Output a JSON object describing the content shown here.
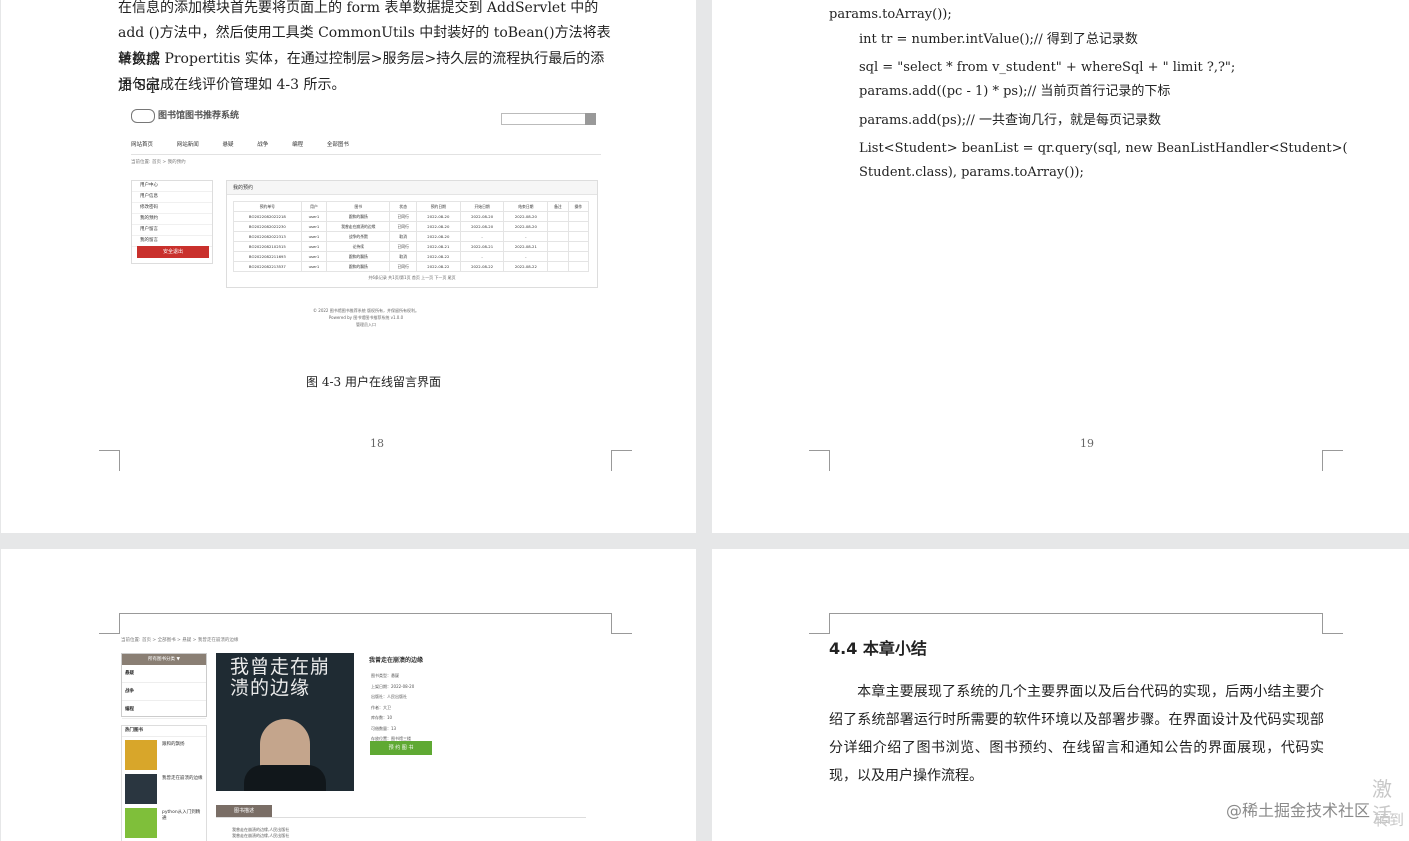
{
  "page18": {
    "para_lines": [
      "在信息的添加模块首先要将页面上的 form 表单数据提交到 AddServlet 中的",
      "add ()方法中，然后使用工具类 CommonUtils 中封装好的 toBean()方法将表单数据",
      "转换成 Propertitis 实体，在通过控制层>服务层>持久层的流程执行最后的添加 Sql",
      "语句完成在线评价管理如 4-3 所示。"
    ],
    "screenshot": {
      "logo": "图书馆图书推荐系统",
      "nav": [
        "网站首页",
        "网站新闻",
        "悬疑",
        "战争",
        "编程",
        "全部图书"
      ],
      "breadcrumb": "当前位置: 首页 > 我的预约",
      "sidebar": [
        "用户中心",
        "用户信息",
        "修改密码",
        "我的预约",
        "用户留言",
        "我的留言"
      ],
      "logout": "安全退出",
      "panel_title": "我的预约",
      "table_headers": [
        "预约单号",
        "用户",
        "图书",
        "状态",
        "预约日期",
        "开始日期",
        "结束日期",
        "备注",
        "操作"
      ],
      "rows": [
        [
          "BO2022082022218",
          "user1",
          "跟和的飘扬",
          "已同行",
          "2022-08-20",
          "2022-08-20",
          "2022-08-20",
          "",
          ""
        ],
        [
          "BO2022082022230",
          "user1",
          "我曾走在崩溃的边缘",
          "已同行",
          "2022-08-20",
          "2022-08-20",
          "2022-08-20",
          "",
          ""
        ],
        [
          "BO2022082022313",
          "user1",
          "战争的杀戮",
          "取消",
          "2022-08-20",
          "-",
          "-",
          "",
          ""
        ],
        [
          "BO2022082102515",
          "user1",
          "论持续",
          "已同行",
          "2022-08-21",
          "2022-08-21",
          "2022-08-21",
          "",
          ""
        ],
        [
          "BO2022082211693",
          "user1",
          "跟和的飘扬",
          "取消",
          "2022-08-22",
          "-",
          "-",
          "",
          ""
        ],
        [
          "BO2022082213537",
          "user1",
          "跟和的飘扬",
          "已同行",
          "2022-08-22",
          "2022-08-22",
          "2022-08-22",
          "",
          ""
        ]
      ],
      "pager": "共6条记录  共1页/第1页  首页  上一页  下一页  尾页",
      "footer": [
        "© 2022 图书馆图书推荐系统 版权所有，并保留所有权利。",
        "Powered by 图书馆图书推荐系统 v1.0.0",
        "管理员入口"
      ]
    },
    "caption": "图  4-3  用户在线留言界面",
    "page_number": "18"
  },
  "page19": {
    "code_lines": [
      "params.toArray());",
      "int tr = number.intValue();//  得到了总记录数",
      "sql = \"select * from v_student\" + whereSql + \" limit ?,?\";",
      "params.add((pc - 1) * ps);//  当前页首行记录的下标",
      "params.add(ps);//  一共查询几行，就是每页记录数",
      "List<Student> beanList = qr.query(sql, new BeanListHandler<Student>(",
      "Student.class), params.toArray());"
    ],
    "page_number": "19"
  },
  "page20": {
    "breadcrumb": "当前位置: 首页 > 全部图书 > 悬疑 > 我曾走在崩溃的边缘",
    "category_header": "所有图书分类 ▼",
    "categories": [
      "悬疑",
      "战争",
      "编程"
    ],
    "hot_header": "热门图书",
    "hot_books": [
      "跟和的飘扬",
      "我曾走在崩溃的边缘",
      "python从入门到精通"
    ],
    "cover_title": "我曾走在崩溃的边缘",
    "book_title": "我曾走在崩溃的边缘",
    "meta": [
      "图书类型：悬疑",
      "上架日期：2022-08-20",
      "出版社：人民出版社",
      "作者：大卫",
      "库存数：10",
      "可借数量：13",
      "存放位置：图书馆三楼"
    ],
    "reserve_button": "预 约 图 书",
    "desc_tab": "图书描述",
    "desc_text": [
      "我曾走在崩溃的边缘,人民出版社",
      "我曾走在崩溃的边缘,人民出版社"
    ]
  },
  "page21": {
    "heading": "4.4  本章小结",
    "summary": "本章主要展现了系统的几个主要界面以及后台代码的实现，后两小结主要介绍了系统部署运行时所需要的软件环境以及部署步骤。在界面设计及代码实现部分详细介绍了图书浏览、图书预约、在线留言和通知公告的界面展现，代码实现，以及用户操作流程。"
  },
  "overlay": {
    "watermark": "@稀土掘金技术社区",
    "activate_line1": "激活",
    "activate_line2": "转到"
  }
}
